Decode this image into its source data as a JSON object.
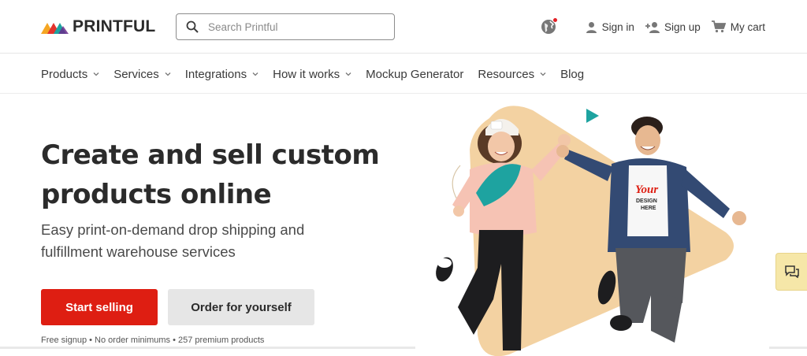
{
  "header": {
    "logo_text": "PRINTFUL",
    "search": {
      "placeholder": "Search Printful",
      "value": ""
    },
    "actions": {
      "sign_in": "Sign in",
      "sign_up": "Sign up",
      "cart": "My cart"
    }
  },
  "nav": {
    "items": [
      {
        "label": "Products",
        "has_dropdown": true
      },
      {
        "label": "Services",
        "has_dropdown": true
      },
      {
        "label": "Integrations",
        "has_dropdown": true
      },
      {
        "label": "How it works",
        "has_dropdown": true
      },
      {
        "label": "Mockup Generator",
        "has_dropdown": false
      },
      {
        "label": "Resources",
        "has_dropdown": true
      },
      {
        "label": "Blog",
        "has_dropdown": false
      }
    ]
  },
  "hero": {
    "headline_line1": "Create and sell custom",
    "headline_line2": "products online",
    "subhead_line1": "Easy print-on-demand drop shipping and",
    "subhead_line2": "fulfillment warehouse services",
    "primary_button": "Start selling",
    "secondary_button": "Order for yourself",
    "fine_print": "Free signup • No order minimums • 257 premium products",
    "tshirt_text_1": "Your",
    "tshirt_text_2": "DESIGN",
    "tshirt_text_3": "HERE"
  },
  "icons": {
    "search": "search-icon",
    "globe": "globe-icon",
    "user": "user-icon",
    "add_user": "add-user-icon",
    "cart": "cart-icon",
    "chevron": "chevron-down-icon",
    "feedback": "chat-icon",
    "play": "play-icon"
  },
  "colors": {
    "primary_red": "#de1e12",
    "teal": "#1ea3a0",
    "peach": "#f3d2a2",
    "feedback_yellow": "#f6e7a8"
  }
}
